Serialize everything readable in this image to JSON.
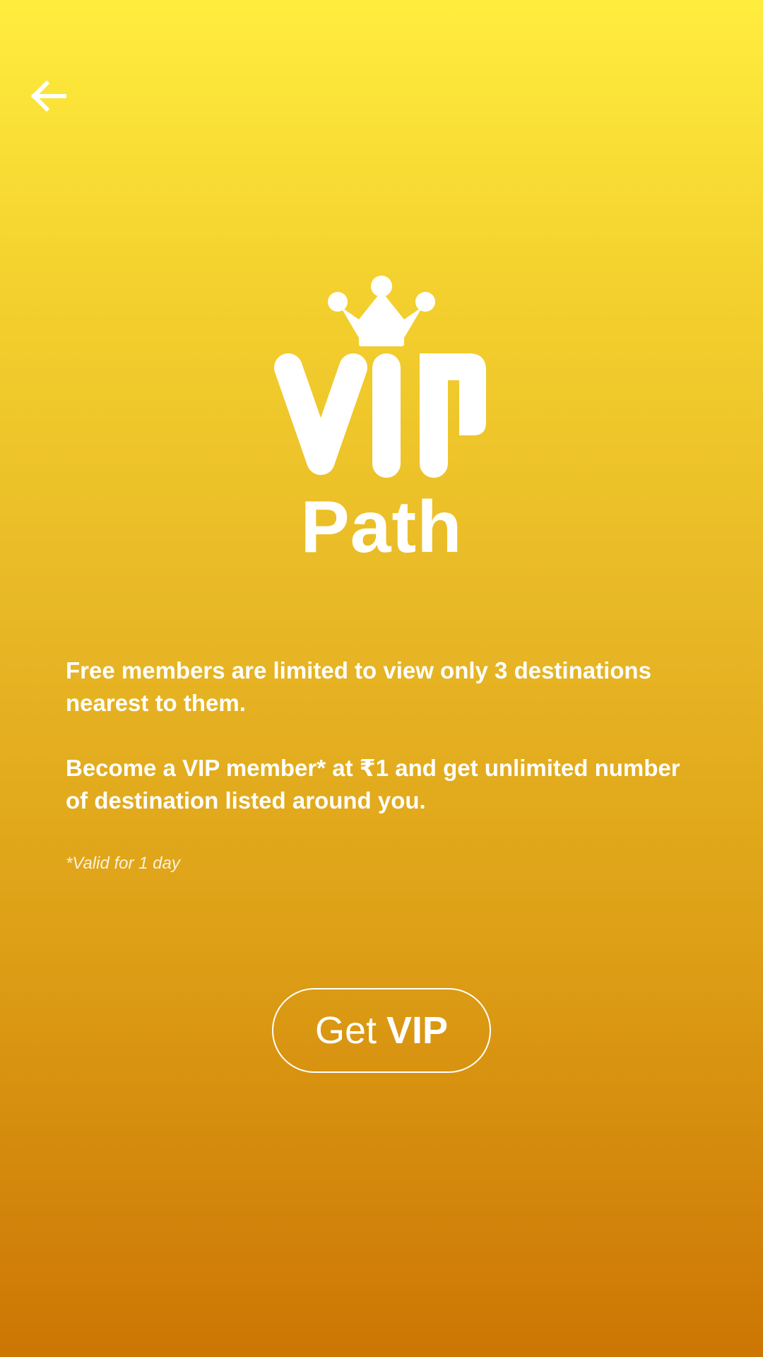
{
  "header": {
    "back_icon": "arrow-left-icon"
  },
  "logo": {
    "crown_icon": "crown-icon",
    "wordmark": "VIP",
    "brand": "Path"
  },
  "content": {
    "paragraph_1": "Free members are limited to view only 3 destinations nearest to them.",
    "paragraph_2": "Become a VIP member* at ₹1 and get unlimited number of destination listed around you.",
    "footnote": "*Valid for 1 day"
  },
  "cta": {
    "light": "Get",
    "bold": "VIP"
  },
  "colors": {
    "gradient_top": "#ffed3e",
    "gradient_bottom": "#cc7604",
    "text": "#ffffff"
  }
}
